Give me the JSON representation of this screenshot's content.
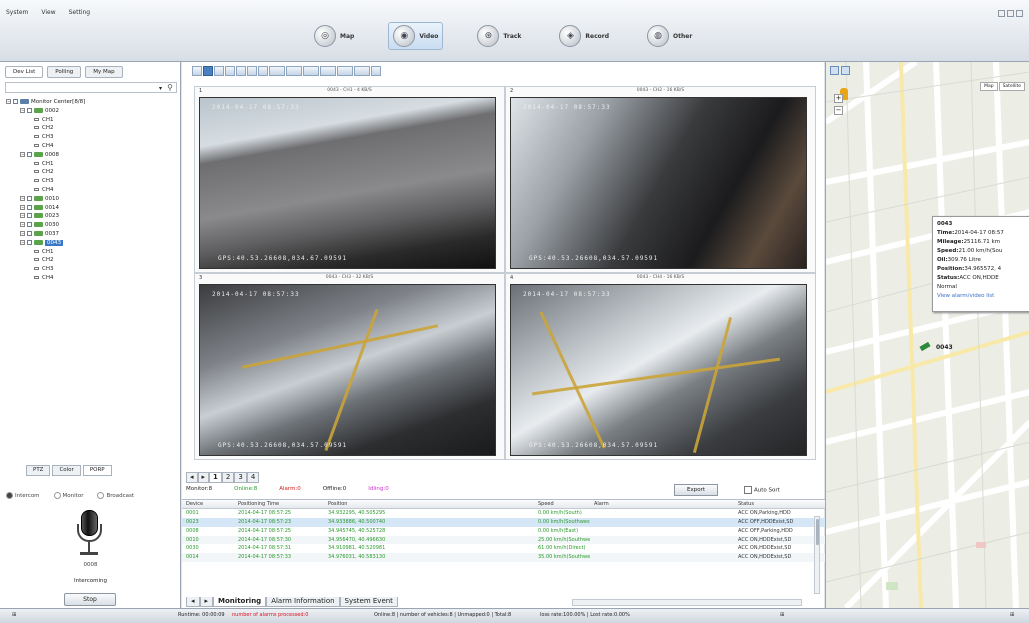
{
  "menus": [
    "System",
    "View",
    "Setting"
  ],
  "modes": [
    {
      "label": "Map",
      "icon": "globe-icon",
      "active": false
    },
    {
      "label": "Video",
      "icon": "camera-icon",
      "active": true
    },
    {
      "label": "Track",
      "icon": "track-icon",
      "active": false
    },
    {
      "label": "Record",
      "icon": "record-icon",
      "active": false
    },
    {
      "label": "Other",
      "icon": "other-icon",
      "active": false
    }
  ],
  "left": {
    "tabs": [
      "Dev List",
      "Polling",
      "My Map"
    ],
    "tree": [
      {
        "level": 0,
        "label": "Monitor Center[8/8]",
        "type": "root"
      },
      {
        "level": 1,
        "label": "0002",
        "type": "vehicle"
      },
      {
        "level": 2,
        "label": "CH1",
        "type": "channel"
      },
      {
        "level": 2,
        "label": "CH2",
        "type": "channel"
      },
      {
        "level": 2,
        "label": "CH3",
        "type": "channel"
      },
      {
        "level": 2,
        "label": "CH4",
        "type": "channel"
      },
      {
        "level": 1,
        "label": "0008",
        "type": "vehicle"
      },
      {
        "level": 2,
        "label": "CH1",
        "type": "channel"
      },
      {
        "level": 2,
        "label": "CH2",
        "type": "channel"
      },
      {
        "level": 2,
        "label": "CH3",
        "type": "channel"
      },
      {
        "level": 2,
        "label": "CH4",
        "type": "channel"
      },
      {
        "level": 1,
        "label": "0010",
        "type": "vehicle"
      },
      {
        "level": 1,
        "label": "0014",
        "type": "vehicle"
      },
      {
        "level": 1,
        "label": "0023",
        "type": "vehicle"
      },
      {
        "level": 1,
        "label": "0030",
        "type": "vehicle"
      },
      {
        "level": 1,
        "label": "0037",
        "type": "vehicle"
      },
      {
        "level": 1,
        "label": "0043",
        "type": "vehicle",
        "selected": true
      },
      {
        "level": 2,
        "label": "CH1",
        "type": "channel"
      },
      {
        "level": 2,
        "label": "CH2",
        "type": "channel"
      },
      {
        "level": 2,
        "label": "CH3",
        "type": "channel"
      },
      {
        "level": 2,
        "label": "CH4",
        "type": "channel"
      }
    ],
    "ptz_tabs": [
      "PTZ",
      "Color",
      "PORP"
    ],
    "radios": [
      {
        "label": "Intercom",
        "on": true
      },
      {
        "label": "Monitor",
        "on": false
      },
      {
        "label": "Broadcast",
        "on": false
      }
    ],
    "mic_number": "0008",
    "mic_label": "Intercoming",
    "stop_label": "Stop"
  },
  "videos": [
    {
      "num": "1",
      "header": "0043 - CH1 - 4 KB/S",
      "ts": "2014-04-17 08:57:33",
      "gps": "GPS:40.53.26608,034.67.09591"
    },
    {
      "num": "2",
      "header": "0043 - CH2 - 16 KB/S",
      "ts": "2014-04-17 08:57:33",
      "gps": "GPS:40.53.26608,034.57.09591"
    },
    {
      "num": "3",
      "header": "0043 - CH3 - 32 KB/S",
      "ts": "2014-04-17 08:57:33",
      "gps": "GPS:40.53.26608,034.57.09591"
    },
    {
      "num": "4",
      "header": "0043 - CH4 - 16 KB/S",
      "ts": "2014-04-17 08:57:33",
      "gps": "GPS:40.53.26608,034.57.09591"
    }
  ],
  "page_tabs": [
    "1",
    "2",
    "3",
    "4"
  ],
  "legend": [
    {
      "label": "Monitor:8",
      "color": "#222222"
    },
    {
      "label": "Online:8",
      "color": "#2a9a2a"
    },
    {
      "label": "Alarm:0",
      "color": "#d11a1a"
    },
    {
      "label": "Offline:0",
      "color": "#222222"
    },
    {
      "label": "Idling:0",
      "color": "#cc33cc"
    }
  ],
  "export_label": "Export",
  "autosort_label": "Auto Sort",
  "table": {
    "headers": [
      "Device",
      "Positioning Time",
      "Position",
      "Speed",
      "Alarm",
      "Status"
    ],
    "rows": [
      [
        "0001",
        "2014-04-17 08:57:25",
        "34.932295, 40.505295",
        "0.00 km/h(South)",
        "",
        "ACC ON,Parking,HDD"
      ],
      [
        "0023",
        "2014-04-17 08:57:23",
        "34.933886, 40.500740",
        "0.00 km/h(Southwest)",
        "",
        "ACC OFF,HDDExist,SD"
      ],
      [
        "0008",
        "2014-04-17 08:57:25",
        "34.945745, 40.525728",
        "0.00 km/h(East)",
        "",
        "ACC OFF,Parking,HDD"
      ],
      [
        "0010",
        "2014-04-17 08:57:30",
        "34.956470, 40.496630",
        "25.00 km/h(Southwest)",
        "",
        "ACC ON,HDDExist,SD"
      ],
      [
        "0030",
        "2014-04-17 08:57:31",
        "34.910981, 40.520981",
        "61.00 km/h(Direct)",
        "",
        "ACC ON,HDDExist,SD"
      ],
      [
        "0014",
        "2014-04-17 08:57:33",
        "34.976031, 40.583130",
        "35.00 km/h(Southwest)",
        "",
        "ACC ON,HDDExist,SD"
      ]
    ]
  },
  "bottom_tabs": [
    "Monitoring",
    "Alarm Information",
    "System Event"
  ],
  "map": {
    "info": {
      "title": "0043",
      "time": "2014-04-17 08:57",
      "mileage": "25116.71 km",
      "speed": "21.00 km/h(Sou",
      "oil": "309.76 Litre",
      "position": "34.965572, 4",
      "status": "ACC ON,HDDE",
      "extra": "Normal",
      "link": "View alarm/video list"
    },
    "vehicle_label": "0043",
    "buttons": [
      "Map",
      "Satellite"
    ]
  },
  "status": {
    "runtime": "Runtime: 00:00:09",
    "alarm": "number of alarms processed:0",
    "online": "Online:8 | number of vehicles:8 | Unmapped:0 | Total:8",
    "loss": "loss rate:100.00% | Lost rate:0.00%"
  }
}
